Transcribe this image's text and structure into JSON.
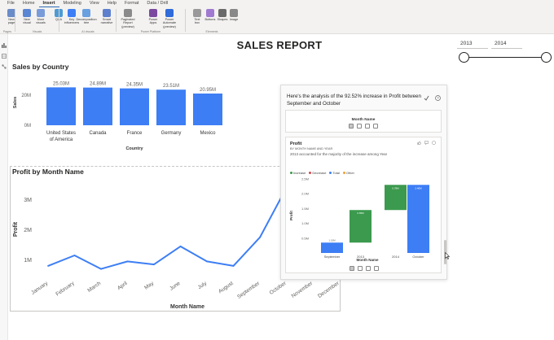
{
  "ribbon": {
    "tabs": [
      "File",
      "Home",
      "Insert",
      "Modeling",
      "View",
      "Help",
      "Format",
      "Data / Drill"
    ],
    "active_tab": "Insert",
    "buttons": [
      "New\npage",
      "New\nvisual",
      "More\nvisuals",
      "Q&A",
      "Key\ninfluencers",
      "Decomposition\ntree",
      "Smart\nnarrative",
      "Paginated Report\n(preview)",
      "Power\nApps",
      "Power Automate\n(preview)",
      "Text\nbox",
      "Buttons",
      "Shapes",
      "Image"
    ],
    "groups": [
      "Pages",
      "Visuals",
      "AI visuals",
      "Power Platform",
      "Elements"
    ]
  },
  "report_title": "SALES REPORT",
  "slicer": {
    "start_label": "2013",
    "end_label": "2014",
    "range": [
      2013,
      2014
    ]
  },
  "sales_by_country": {
    "title": "Sales by Country",
    "chart_data": {
      "type": "bar",
      "categories": [
        "United States of America",
        "Canada",
        "France",
        "Germany",
        "Mexico"
      ],
      "values": [
        25.03,
        24.89,
        24.35,
        23.51,
        20.95
      ],
      "data_labels": [
        "25.03M",
        "24.89M",
        "24.35M",
        "23.51M",
        "20.95M"
      ],
      "xlabel": "Country",
      "ylabel": "Sales",
      "ytick_labels": [
        "0M",
        "20M"
      ],
      "yticks": [
        0,
        20
      ],
      "ylim": [
        0,
        29
      ],
      "color": "#3d7ef5",
      "grid": false
    }
  },
  "profit_by_month": {
    "title": "Profit by Month Name",
    "chart_data": {
      "type": "line",
      "categories": [
        "January",
        "February",
        "March",
        "April",
        "May",
        "June",
        "July",
        "August",
        "September",
        "October",
        "November",
        "December"
      ],
      "values": [
        0.8,
        1.15,
        0.7,
        0.95,
        0.85,
        1.45,
        0.95,
        0.8,
        1.75,
        3.4,
        2.35
      ],
      "xlabel": "Month Name",
      "ylabel": "Profit",
      "ytick_labels": [
        "1M",
        "2M",
        "3M"
      ],
      "yticks": [
        1,
        2,
        3
      ],
      "ylim": [
        0.5,
        3.75
      ],
      "color": "#3d7ef5",
      "grid": false
    }
  },
  "qa_panel": {
    "question": "Here's the analysis of the 92.52% increase in Profit between September and October",
    "top_card_label": "Month Name",
    "chart_title": "Profit",
    "chart_subtitle": "BY MONTH NAME AND YEAR",
    "chart_note": "2013 accounted for the majority of the increase among Year",
    "legend": [
      "Increase",
      "Decrease",
      "Total",
      "Other"
    ],
    "legend_colors": [
      "#3c9a4e",
      "#d64550",
      "#3d7ef5",
      "#f0a030"
    ],
    "chart_data": {
      "type": "bar",
      "subtype": "waterfall",
      "categories": [
        "September",
        "2013",
        "2014",
        "October"
      ],
      "values": [
        0.35,
        1.1,
        0.85,
        2.3
      ],
      "kinds": [
        "total",
        "increase",
        "increase",
        "total"
      ],
      "data_labels": [
        "1.15M",
        "0.65M",
        "0.78M",
        "2.40M"
      ],
      "xlabel": "Month Name",
      "ylabel": "Profit",
      "ytick_labels": [
        "0.5M",
        "1.0M",
        "1.5M",
        "2.0M",
        "2.5M"
      ],
      "yticks": [
        0.5,
        1.0,
        1.5,
        2.0,
        2.5
      ],
      "ylim": [
        0,
        2.5
      ]
    },
    "bottom_label": "Month Name"
  }
}
